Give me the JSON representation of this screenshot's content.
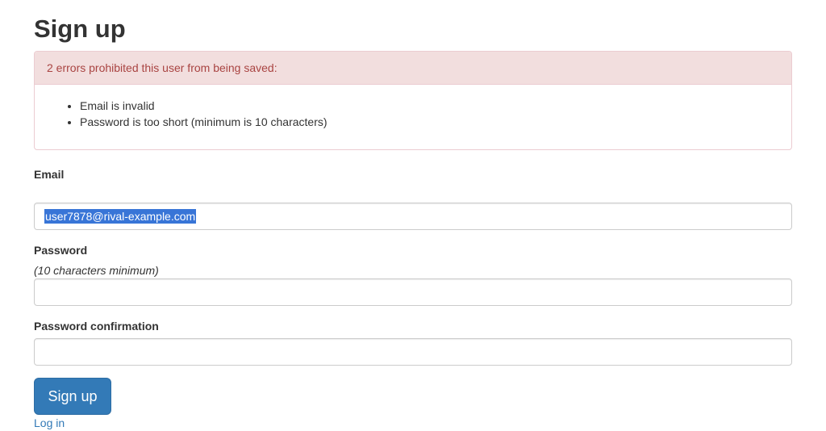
{
  "page": {
    "title": "Sign up"
  },
  "errors": {
    "heading": "2 errors prohibited this user from being saved:",
    "items": [
      "Email is invalid",
      "Password is too short (minimum is 10 characters)"
    ]
  },
  "form": {
    "email": {
      "label": "Email",
      "value": "user7878@rival-example.com"
    },
    "password": {
      "label": "Password",
      "help": "(10 characters minimum)",
      "value": ""
    },
    "password_confirmation": {
      "label": "Password confirmation",
      "value": ""
    },
    "submit_label": "Sign up",
    "login_link": "Log in"
  },
  "colors": {
    "primary": "#337ab7",
    "error_text": "#a94442",
    "error_bg": "#f2dede",
    "error_border": "#ebccd1",
    "selection": "#3875d7"
  }
}
